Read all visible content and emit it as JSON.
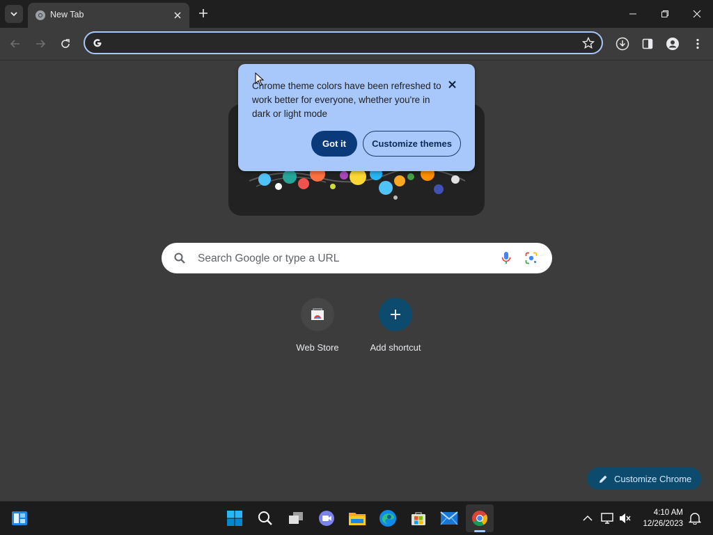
{
  "tab": {
    "title": "New Tab"
  },
  "omnibox": {
    "value": ""
  },
  "bubble": {
    "text": "Chrome theme colors have been refreshed to work better for everyone, whether you're in dark or light mode",
    "got_it": "Got it",
    "customize_themes": "Customize themes"
  },
  "search": {
    "placeholder": "Search Google or type a URL"
  },
  "shortcuts": [
    {
      "label": "Web Store"
    },
    {
      "label": "Add shortcut"
    }
  ],
  "customize_chrome": {
    "label": "Customize Chrome"
  },
  "taskbar": {
    "time": "4:10 AM",
    "date": "12/26/2023"
  },
  "colors": {
    "accent": "#a8c7fa",
    "bubble_button": "#0b3a7a",
    "customize_chrome_bg": "#0c4a6e"
  },
  "icons": [
    "tab-list-icon",
    "chrome-favicon-icon",
    "close-icon",
    "plus-icon",
    "minimize-icon",
    "restore-icon",
    "back-icon",
    "forward-icon",
    "reload-icon",
    "google-g-icon",
    "star-icon",
    "download-icon",
    "side-panel-icon",
    "profile-icon",
    "menu-dots-icon",
    "search-icon",
    "mic-icon",
    "lens-icon",
    "pencil-icon",
    "widgets-icon",
    "start-icon",
    "task-view-icon",
    "chat-icon",
    "file-explorer-icon",
    "edge-icon",
    "store-icon",
    "mail-icon",
    "chrome-icon",
    "chevron-up-icon",
    "network-icon",
    "volume-icon",
    "notification-icon"
  ]
}
